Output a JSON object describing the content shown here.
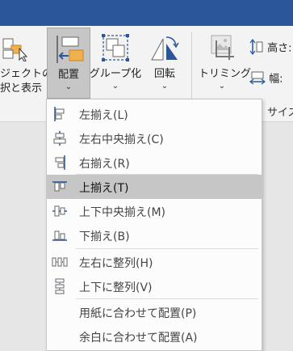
{
  "ribbon": {
    "selection_pane": {
      "label_line1": "ジェクトの",
      "label_line2": "択と表示"
    },
    "arrange": {
      "label": "配置",
      "chevron": "⌄"
    },
    "group": {
      "label": "グループ化",
      "chevron": "⌄"
    },
    "rotate": {
      "label": "回転",
      "chevron": "⌄"
    },
    "crop": {
      "label": "トリミング",
      "chevron": "⌄"
    },
    "height_label": "高さ:",
    "width_label": "幅:",
    "size_group_label": "サイズ"
  },
  "colors": {
    "title_bar": "#2b579a",
    "highlight": "#c6c6c6",
    "accent_orange": "#f0b050",
    "icon_blue": "#2b579a"
  },
  "menu": {
    "items": [
      {
        "label": "左揃え(L)",
        "icon": "align-left-icon"
      },
      {
        "label": "左右中央揃え(C)",
        "icon": "align-center-icon"
      },
      {
        "label": "右揃え(R)",
        "icon": "align-right-icon"
      },
      {
        "label": "上揃え(T)",
        "icon": "align-top-icon",
        "highlighted": true
      },
      {
        "label": "上下中央揃え(M)",
        "icon": "align-middle-icon"
      },
      {
        "label": "下揃え(B)",
        "icon": "align-bottom-icon"
      },
      {
        "label": "左右に整列(H)",
        "icon": "distribute-horizontal-icon"
      },
      {
        "label": "上下に整列(V)",
        "icon": "distribute-vertical-icon"
      },
      {
        "label": "用紙に合わせて配置(P)",
        "icon": ""
      },
      {
        "label": "余白に合わせて配置(A)",
        "icon": ""
      }
    ]
  }
}
